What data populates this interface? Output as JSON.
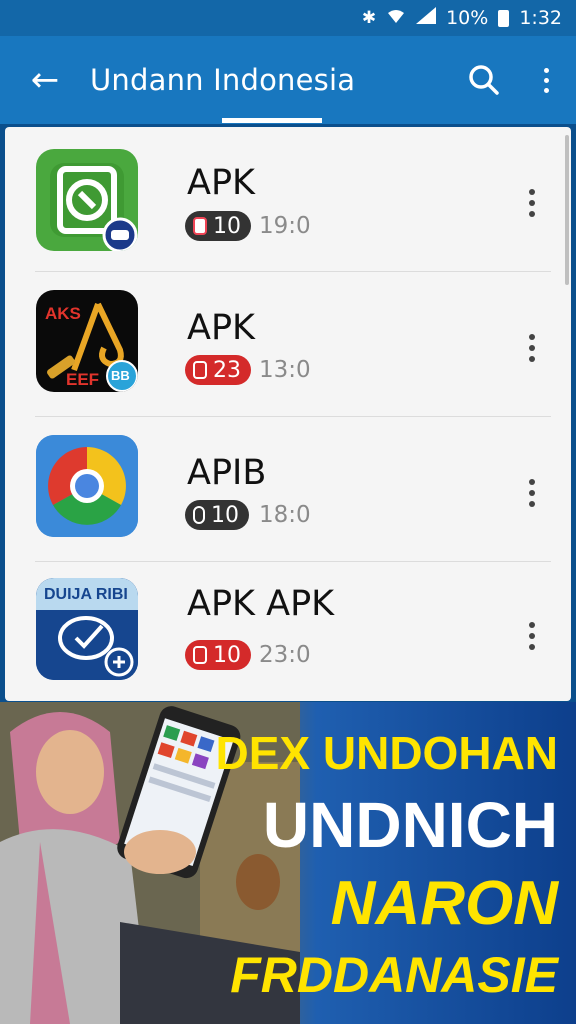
{
  "status_bar": {
    "bluetooth_icon": "bluetooth-icon",
    "wifi_icon": "wifi-icon",
    "signal_icon": "signal-icon",
    "battery_text": "10%",
    "time": "1:32"
  },
  "app_bar": {
    "title": "Undann Indonesia",
    "back_icon": "arrow-back-icon",
    "search_icon": "search-icon",
    "more_icon": "more-vert-icon"
  },
  "list": [
    {
      "name": "APK",
      "badge_value": "10",
      "badge_color": "#333333",
      "time": "19:0",
      "icon": "green-dashboard-app-icon"
    },
    {
      "name": "APK",
      "badge_value": "23",
      "badge_color": "#d42a2a",
      "time": "13:0",
      "icon": "black-gold-app-icon",
      "icon_text_top": "AKS",
      "icon_text_bottom": "EEF",
      "icon_badge": "BB"
    },
    {
      "name": "APIB",
      "badge_value": "10",
      "badge_color": "#333333",
      "time": "18:0",
      "icon": "chrome-icon"
    },
    {
      "name": "APK APK",
      "badge_value": "10",
      "badge_color": "#d42a2a",
      "time": "23:0",
      "icon": "blue-chat-app-icon",
      "icon_text_top": "DUIJA RIBI"
    }
  ],
  "banner": {
    "line1": "DEX UNDOHAN",
    "line2": "UNDNICH",
    "line3": "NARON",
    "line4": "FRDDANASIE",
    "colors": {
      "yellow": "#ffe400",
      "white": "#ffffff"
    }
  }
}
